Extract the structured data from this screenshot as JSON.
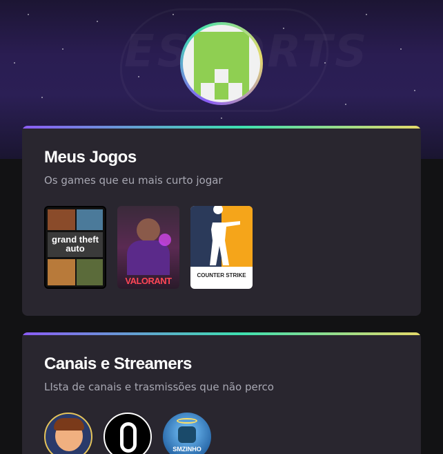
{
  "header": {
    "background_logo_text": "ESPORTS",
    "avatar_icon": "pixel-identicon-icon",
    "accent_gradient": [
      "#8b5cf6",
      "#3ee0b0",
      "#e5d96a"
    ]
  },
  "games_section": {
    "title": "Meus Jogos",
    "subtitle": "Os games que eu mais curto jogar",
    "games": [
      {
        "name": "Grand Theft Auto V",
        "cover_text": "grand theft auto",
        "icon": "gta-cover"
      },
      {
        "name": "Valorant",
        "cover_text": "VALORANT",
        "icon": "valorant-cover"
      },
      {
        "name": "Counter-Strike",
        "cover_text": "COUNTER STRIKE",
        "icon": "counter-strike-cover"
      }
    ]
  },
  "channels_section": {
    "title": "Canais e Streamers",
    "subtitle": "LIsta de canais e trasmissões que não perco",
    "channels": [
      {
        "icon": "streamer-avatar-1"
      },
      {
        "icon": "streamer-avatar-2"
      },
      {
        "icon": "streamer-avatar-3",
        "label": "SMZINHO"
      }
    ]
  },
  "colors": {
    "page_bg": "#121214",
    "card_bg": "#29262f",
    "title": "#ffffff",
    "subtitle": "#a8a8b3"
  }
}
